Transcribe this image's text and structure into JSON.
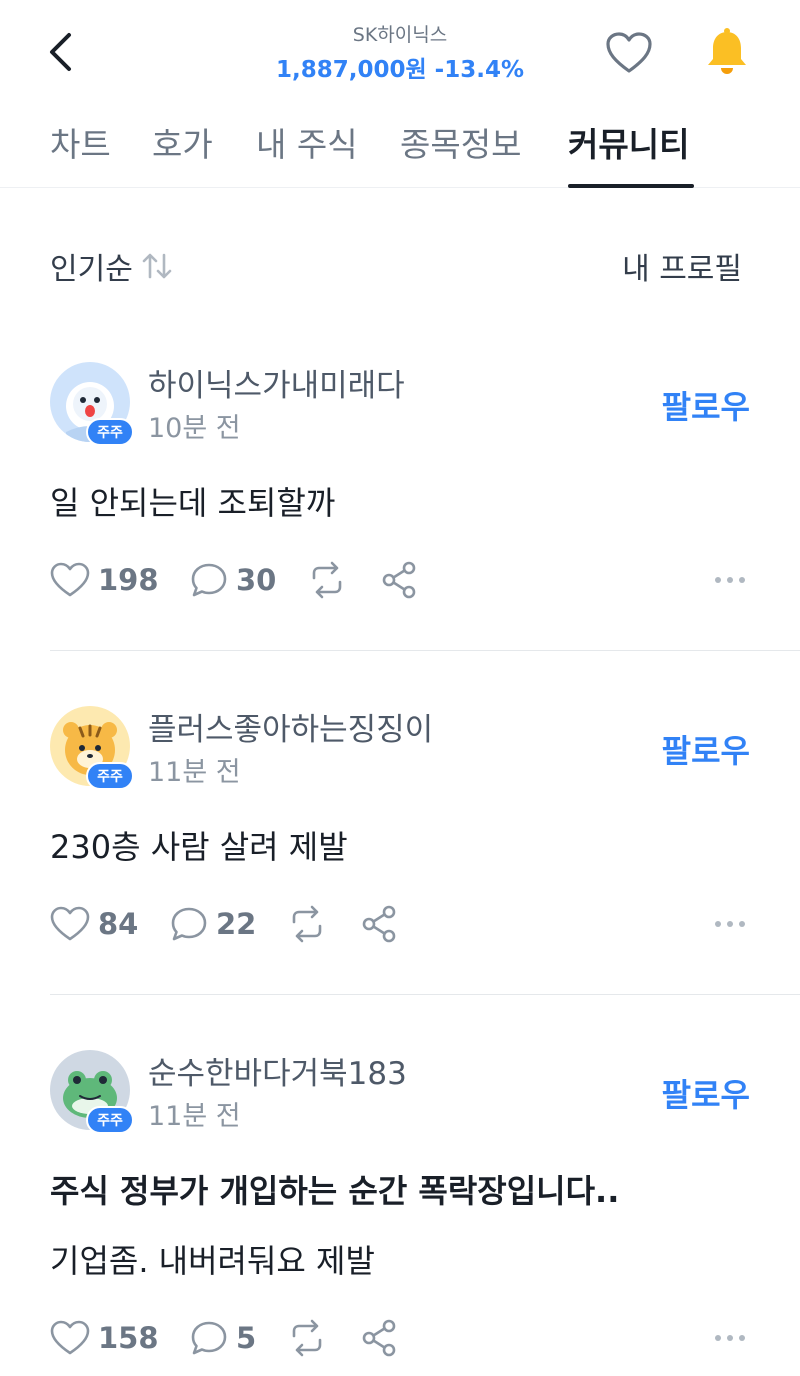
{
  "header": {
    "stock_name": "SK하이닉스",
    "price": "1,887,000원",
    "change": "-13.4%",
    "bell_color": "#fbbf24",
    "accent": "#3182f6"
  },
  "tabs": [
    {
      "label": "차트",
      "active": false
    },
    {
      "label": "호가",
      "active": false
    },
    {
      "label": "내 주식",
      "active": false
    },
    {
      "label": "종목정보",
      "active": false
    },
    {
      "label": "커뮤니티",
      "active": true
    }
  ],
  "sort": {
    "label": "인기순",
    "icon": "sort-arrows-icon"
  },
  "profile_label": "내 프로필",
  "posts": [
    {
      "username": "하이닉스가내미래다",
      "time": "10분 전",
      "badge": "주주",
      "follow": "팔로우",
      "title": "",
      "text": "일 안되는데 조퇴할까",
      "likes": "198",
      "comments": "30",
      "avatar": "ghost-avatar"
    },
    {
      "username": "플러스좋아하는징징이",
      "time": "11분 전",
      "badge": "주주",
      "follow": "팔로우",
      "title": "",
      "text": "230층 사람 살려 제발",
      "likes": "84",
      "comments": "22",
      "avatar": "tiger-avatar"
    },
    {
      "username": "순수한바다거북183",
      "time": "11분 전",
      "badge": "주주",
      "follow": "팔로우",
      "title": "주식 정부가 개입하는 순간 폭락장입니다..",
      "text": "기업좀. 내버려둬요 제발",
      "likes": "158",
      "comments": "5",
      "avatar": "frog-avatar"
    }
  ]
}
